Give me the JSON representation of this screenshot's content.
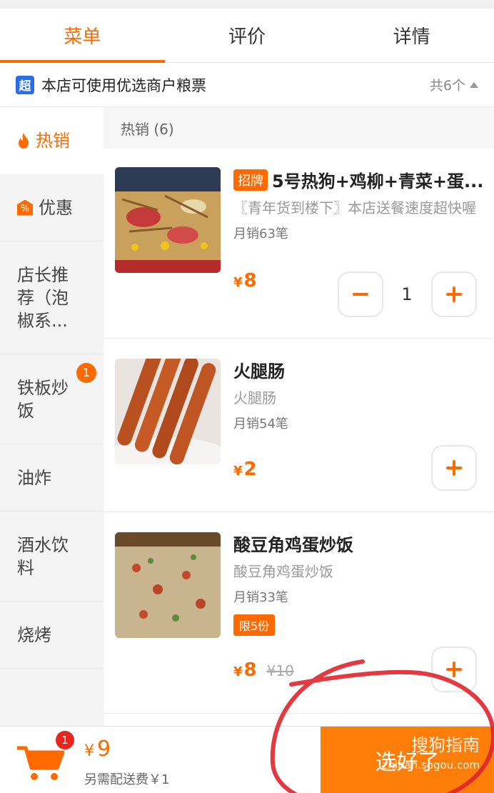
{
  "tabs": [
    {
      "label": "菜单",
      "active": true
    },
    {
      "label": "评价",
      "active": false
    },
    {
      "label": "详情",
      "active": false
    }
  ],
  "notice": {
    "badge": "超",
    "text": "本店可使用优选商户粮票",
    "count": "共6个"
  },
  "sidebar": {
    "items": [
      {
        "label": "热销",
        "icon": "fire-icon",
        "active": true
      },
      {
        "label": "优惠",
        "icon": "percent-tag-icon"
      },
      {
        "label": "店长推\n荐（泡\n椒系..."
      },
      {
        "label": "铁板炒\n饭",
        "badge": "1"
      },
      {
        "label": "油炸"
      },
      {
        "label": "酒水饮\n料"
      },
      {
        "label": "烧烤"
      }
    ]
  },
  "section": {
    "title": "热销 (6)"
  },
  "items": [
    {
      "tag": "招牌",
      "name": "5号热狗+鸡柳+青菜+蛋...",
      "desc": "〖青年货到楼下〗本店送餐速度超快喔",
      "sales": "月销63笔",
      "currency": "¥",
      "price": "8",
      "qty": "1"
    },
    {
      "name": "火腿肠",
      "desc": "火腿肠",
      "sales": "月销54笔",
      "currency": "¥",
      "price": "2"
    },
    {
      "name": "酸豆角鸡蛋炒饭",
      "desc": "酸豆角鸡蛋炒饭",
      "sales": "月销33笔",
      "limit": "限5份",
      "currency": "¥",
      "price": "8",
      "old_price": "¥10"
    }
  ],
  "bottom": {
    "cart_badge": "1",
    "currency": "¥",
    "total": "9",
    "fee": "另需配送费￥1",
    "checkout": "选好了",
    "watermark": "搜狗指南",
    "watermark_url": "zhinan.sogou.com"
  },
  "colors": {
    "accent": "#ff6a00",
    "checkout_bg": "#ff7e0a",
    "annotation": "#e0252c"
  }
}
